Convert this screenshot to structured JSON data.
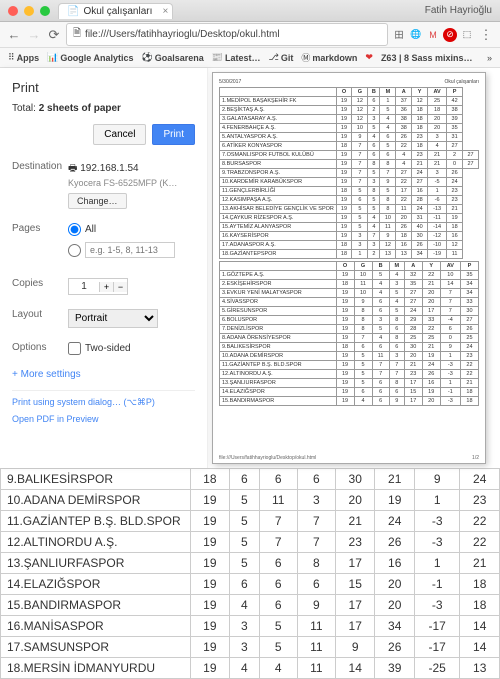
{
  "window": {
    "tab_title": "Okul çalışanları",
    "user": "Fatih Hayrioğlu"
  },
  "url": "file:///Users/fatihhayrioglu/Desktop/okul.html",
  "bookmarks": [
    "Apps",
    "Google Analytics",
    "Goalsarena",
    "Latest…",
    "Git",
    "markdown",
    "Z63 | 8 Sass mixins…"
  ],
  "print": {
    "title": "Print",
    "total_pre": "Total: ",
    "total_bold": "2 sheets of paper",
    "cancel": "Cancel",
    "print": "Print",
    "dest_label": "Destination",
    "printer_name": "192.168.1.54",
    "printer_desc": "Kyocera FS-6525MFP (K…",
    "change": "Change…",
    "pages_label": "Pages",
    "all": "All",
    "range_ph": "e.g. 1-5, 8, 11-13",
    "copies_label": "Copies",
    "copies_val": "1",
    "layout_label": "Layout",
    "layout_val": "Portrait",
    "options_label": "Options",
    "two_sided": "Two-sided",
    "more": "More settings",
    "sys": "Print using system dialog… (⌥⌘P)",
    "pdf": "Open PDF in Preview"
  },
  "preview": {
    "date": "5/30/2017",
    "title": "Okul çalışanları",
    "cols": [
      "",
      "O",
      "G",
      "B",
      "M",
      "A",
      "Y",
      "AV",
      "P"
    ],
    "footer_path": "file:///Users/fatihhayrioglu/Desktop/okul.html",
    "footer_pg": "1/2"
  },
  "teams1": [
    [
      "1.MEDİPOL BAŞAKŞEHİR FK",
      19,
      12,
      6,
      1,
      37,
      12,
      25,
      42
    ],
    [
      "2.BEŞİKTAŞ A.Ş.",
      19,
      12,
      2,
      5,
      36,
      18,
      18,
      38
    ],
    [
      "3.GALATASARAY A.Ş.",
      19,
      12,
      3,
      4,
      38,
      18,
      20,
      39
    ],
    [
      "4.FENERBAHÇE A.Ş.",
      19,
      10,
      5,
      4,
      38,
      18,
      20,
      35
    ],
    [
      "5.ANTALYASPOR A.Ş.",
      19,
      9,
      4,
      6,
      26,
      23,
      3,
      31
    ],
    [
      "6.ATİKER KONYASPOR",
      18,
      7,
      6,
      5,
      22,
      18,
      4,
      27
    ],
    [
      "7.OSMANLISPOR FUTBOL KULÜBÜ",
      19,
      7,
      6,
      6,
      4,
      23,
      21,
      2,
      27
    ],
    [
      "8.BURSASPOR",
      19,
      7,
      8,
      8,
      4,
      21,
      21,
      0,
      27
    ],
    [
      "9.TRABZONSPOR A.Ş.",
      19,
      7,
      5,
      7,
      27,
      24,
      3,
      26
    ],
    [
      "10.KARDEMİR KARABÜKSPOR",
      19,
      7,
      3,
      9,
      22,
      27,
      -5,
      24
    ],
    [
      "11.GENÇLERBİRLİĞİ",
      18,
      5,
      8,
      5,
      17,
      16,
      1,
      23
    ],
    [
      "12.KASIMPAŞA A.Ş.",
      19,
      6,
      5,
      8,
      22,
      28,
      -6,
      23
    ],
    [
      "13.AKHİSAR BELEDİYE GENÇLİK VE SPOR",
      19,
      5,
      5,
      8,
      11,
      24,
      -13,
      21
    ],
    [
      "14.ÇAYKUR RİZESPOR A.Ş.",
      19,
      5,
      4,
      10,
      20,
      31,
      -11,
      19
    ],
    [
      "15.AYTEMİZ ALANYASPOR",
      19,
      5,
      4,
      11,
      26,
      40,
      -14,
      18
    ],
    [
      "16.KAYSERİSPOR",
      19,
      3,
      7,
      9,
      18,
      30,
      -12,
      16
    ],
    [
      "17.ADANASPOR A.Ş.",
      18,
      3,
      3,
      12,
      16,
      26,
      -10,
      12
    ],
    [
      "18.GAZİANTEPSPOR",
      18,
      1,
      2,
      13,
      13,
      34,
      -19,
      11
    ]
  ],
  "teams2": [
    [
      "1.GÖZTEPE A.Ş.",
      19,
      10,
      5,
      4,
      32,
      22,
      10,
      35
    ],
    [
      "2.ESKİŞEHİRSPOR",
      18,
      11,
      4,
      3,
      35,
      21,
      14,
      34
    ],
    [
      "3.EVKUR YENİ MALATYASPOR",
      19,
      10,
      4,
      5,
      27,
      20,
      7,
      34
    ],
    [
      "4.SİVASSPOR",
      19,
      9,
      6,
      4,
      27,
      20,
      7,
      33
    ],
    [
      "5.GİRESUNSPOR",
      19,
      8,
      6,
      5,
      24,
      17,
      7,
      30
    ],
    [
      "6.BOLUSPOR",
      19,
      8,
      3,
      8,
      29,
      33,
      -4,
      27
    ],
    [
      "7.DENİZLİSPOR",
      19,
      8,
      5,
      6,
      28,
      22,
      6,
      26
    ],
    [
      "8.ADANA ÖRENSİYESPOR",
      19,
      7,
      4,
      8,
      25,
      25,
      0,
      25
    ],
    [
      "9.BALIKESİRSPOR",
      18,
      6,
      6,
      6,
      30,
      21,
      9,
      24
    ],
    [
      "10.ADANA DEMİRSPOR",
      19,
      5,
      11,
      3,
      20,
      19,
      1,
      23
    ],
    [
      "11.GAZİANTEP B.Ş. BLD.SPOR",
      19,
      5,
      7,
      7,
      21,
      24,
      -3,
      22
    ],
    [
      "12.ALTINORDU A.Ş.",
      19,
      5,
      7,
      7,
      23,
      26,
      -3,
      22
    ],
    [
      "13.ŞANLIURFASPOR",
      19,
      5,
      6,
      8,
      17,
      16,
      1,
      21
    ],
    [
      "14.ELAZIĞSPOR",
      19,
      6,
      6,
      6,
      15,
      19,
      -1,
      18
    ],
    [
      "15.BANDIRMASPOR",
      19,
      4,
      6,
      9,
      17,
      20,
      -3,
      18
    ]
  ],
  "under": [
    [
      "9.BALIKESİRSPOR",
      18,
      6,
      6,
      6,
      30,
      21,
      9,
      24
    ],
    [
      "10.ADANA DEMİRSPOR",
      19,
      5,
      11,
      3,
      20,
      19,
      1,
      23
    ],
    [
      "11.GAZİANTEP B.Ş. BLD.SPOR",
      19,
      5,
      7,
      7,
      21,
      24,
      -3,
      22
    ],
    [
      "12.ALTINORDU A.Ş.",
      19,
      5,
      7,
      7,
      23,
      26,
      -3,
      22
    ],
    [
      "13.ŞANLIURFASPOR",
      19,
      5,
      6,
      8,
      17,
      16,
      1,
      21
    ],
    [
      "14.ELAZIĞSPOR",
      19,
      6,
      6,
      6,
      15,
      20,
      -1,
      18
    ],
    [
      "15.BANDIRMASPOR",
      19,
      4,
      6,
      9,
      17,
      20,
      -3,
      18
    ],
    [
      "16.MANİSASPOR",
      19,
      3,
      5,
      11,
      17,
      34,
      -17,
      14
    ],
    [
      "17.SAMSUNSPOR",
      19,
      3,
      5,
      11,
      9,
      26,
      -17,
      14
    ],
    [
      "18.MERSİN İDMANYURDU",
      19,
      4,
      4,
      11,
      14,
      39,
      -25,
      13
    ]
  ]
}
